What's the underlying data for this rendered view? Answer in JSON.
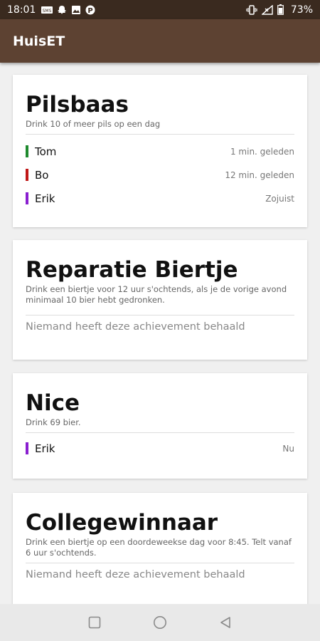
{
  "status_bar": {
    "time": "18:01",
    "battery_percent": "73%",
    "notification_icons": [
      "sms-icon",
      "snapchat-icon",
      "image-icon",
      "parking-icon"
    ],
    "system_icons": [
      "vibrate-icon",
      "no-signal-icon",
      "battery-icon"
    ]
  },
  "app_bar": {
    "title": "HuisET"
  },
  "achievements": [
    {
      "title": "Pilsbaas",
      "description": "Drink 10 of meer pils op een dag",
      "entries": [
        {
          "name": "Tom",
          "when": "1 min. geleden",
          "color": "#1f8a2e"
        },
        {
          "name": "Bo",
          "when": "12 min. geleden",
          "color": "#c01818"
        },
        {
          "name": "Erik",
          "when": "Zojuist",
          "color": "#8a1fd0"
        }
      ]
    },
    {
      "title": "Reparatie Biertje",
      "description": "Drink een biertje voor 12 uur s'ochtends, als je de vorige avond minimaal 10 bier hebt gedronken.",
      "empty_text": "Niemand heeft deze achievement behaald"
    },
    {
      "title": "Nice",
      "description": "Drink 69 bier.",
      "entries": [
        {
          "name": "Erik",
          "when": "Nu",
          "color": "#8a1fd0"
        }
      ]
    },
    {
      "title": "Collegewinnaar",
      "description": "Drink een biertje op een doordeweekse dag voor 8:45. Telt vanaf 6 uur s'ochtends.",
      "empty_text": "Niemand heeft deze achievement behaald"
    }
  ],
  "nav_bar": {
    "buttons": [
      "recents-square-icon",
      "home-circle-icon",
      "back-triangle-icon"
    ]
  },
  "colors": {
    "status_bar": "#3a2a1f",
    "app_bar": "#5d4232",
    "background": "#f0f0f0"
  }
}
